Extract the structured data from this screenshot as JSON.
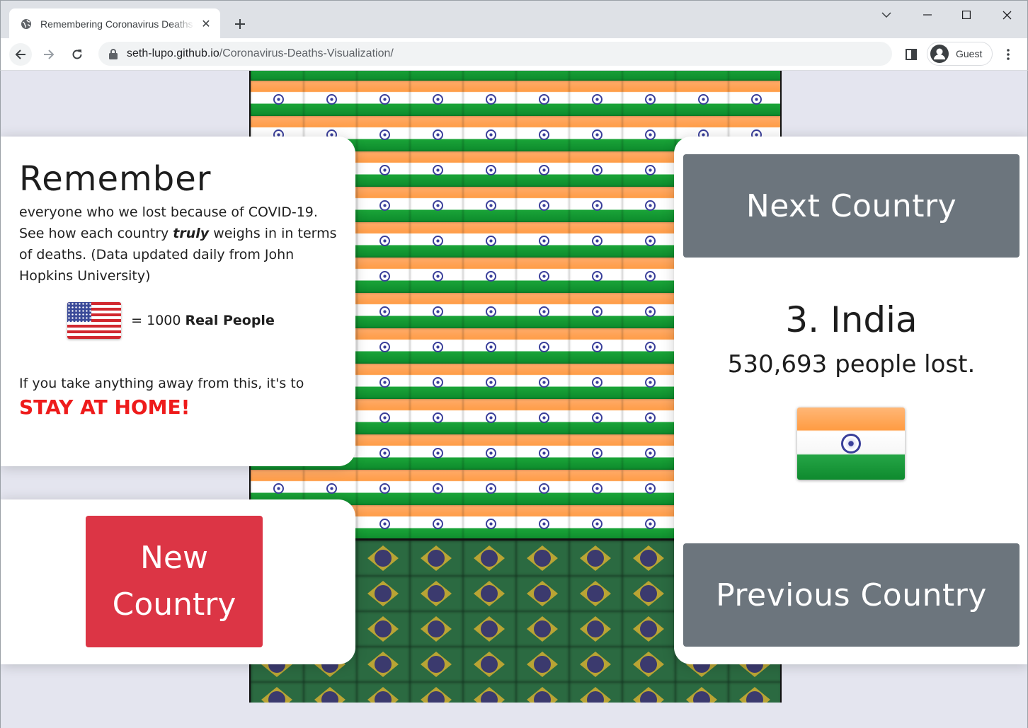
{
  "browser": {
    "tab_title": "Remembering Coronavirus Deaths",
    "url_host": "seth-lupo.github.io",
    "url_path": "/Coronavirus-Deaths-Visualization/",
    "profile_label": "Guest"
  },
  "info": {
    "headline": "Remember",
    "blurb_1": "everyone who we lost because of COVID-19. See how each country ",
    "blurb_em": "truly",
    "blurb_2": " weighs in in terms of deaths. (Data updated daily from John Hopkins University)",
    "legend_prefix": "= 1000 ",
    "legend_bold": "Real People",
    "takeaway": "If you take anything away from this, it's to",
    "stay": "STAY AT HOME!"
  },
  "new_country_label": "New Country",
  "country": {
    "next_label": "Next Country",
    "rank_name": "3. India",
    "deaths_text": "530,693 people lost.",
    "previous_label": "Previous Country"
  },
  "grid": {
    "columns": 10,
    "india_rows": 14,
    "brazil_rows": 6
  },
  "colors": {
    "new_button": "#dc3545",
    "nav_button": "#6c757d",
    "stay_text": "#ee1b1b",
    "page_bg": "#e4e5ef"
  },
  "icons": [
    "globe-icon",
    "close-icon",
    "plus-icon",
    "back-icon",
    "forward-icon",
    "reload-icon",
    "lock-icon",
    "side-panel-icon",
    "profile-icon",
    "menu-icon",
    "minimize-icon",
    "maximize-icon",
    "window-close-icon",
    "chevron-down-icon"
  ]
}
